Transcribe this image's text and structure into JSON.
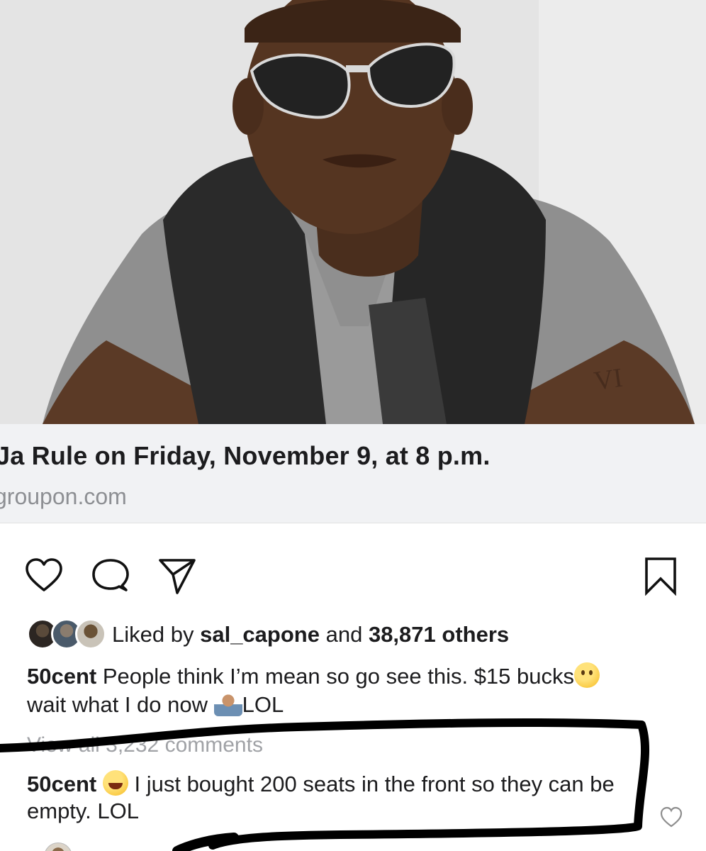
{
  "link_preview": {
    "title": "Ja Rule on Friday, November 9, at 8 p.m.",
    "domain": "groupon.com"
  },
  "actions": {
    "like_icon": "heart-outline",
    "comment_icon": "speech-bubble",
    "share_icon": "paper-plane",
    "save_icon": "bookmark"
  },
  "likes": {
    "prefix": "Liked by",
    "user": "sal_capone",
    "joiner": "and",
    "count_text": "38,871 others"
  },
  "caption": {
    "username": "50cent",
    "text_part1": "People think I’m mean so go see this. $15 bucks",
    "emoji1": "thinking-face",
    "text_part2": "wait what I do now",
    "emoji2": "person-shrugging",
    "text_part3": "LOL"
  },
  "view_all_comments": "View all 3,232 comments",
  "comment": {
    "username": "50cent",
    "emoji": "grinning-squinting-face",
    "text": "I just bought 200 seats in the front so they can be empty. LOL"
  },
  "colors": {
    "text_primary": "#1c1c1e",
    "text_secondary": "#8d8f93",
    "preview_bg": "#f1f2f4",
    "annotation": "#000000"
  }
}
